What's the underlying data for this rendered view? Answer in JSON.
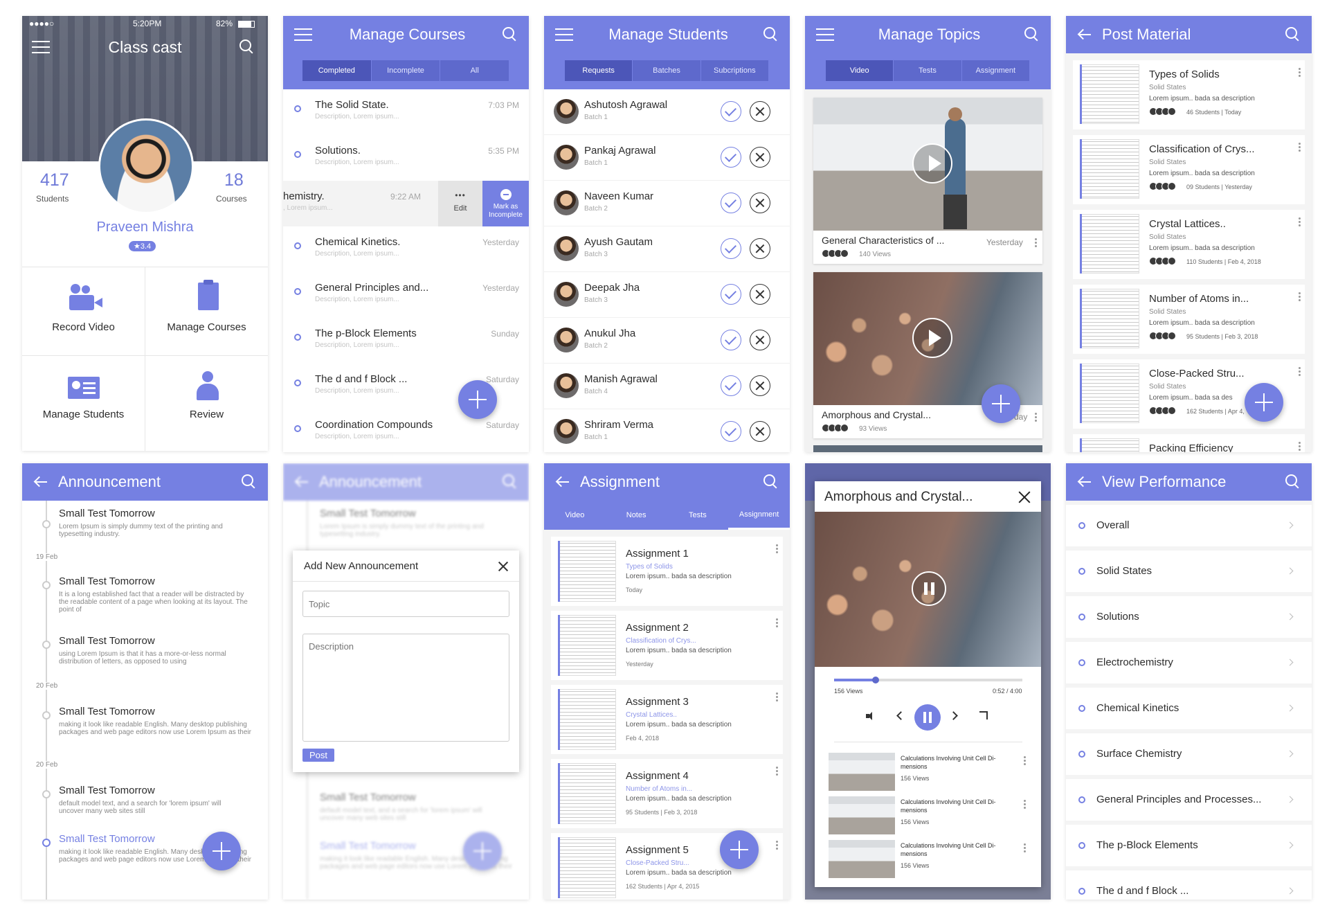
{
  "profile": {
    "status": {
      "carrier": "●●●●○",
      "time": "5:20PM",
      "battery": "82%"
    },
    "title": "Class cast",
    "students_count": "417",
    "students_label": "Students",
    "courses_count": "18",
    "courses_label": "Courses",
    "name": "Praveen Mishra",
    "rating": "★3.4",
    "tiles": [
      "Record Video",
      "Manage Courses",
      "Manage Students",
      "Review"
    ]
  },
  "courses": {
    "title": "Manage Courses",
    "tabs": [
      "Completed",
      "Incomplete",
      "All"
    ],
    "items": [
      {
        "title": "The Solid State.",
        "desc": "Description, Lorem ipsum...",
        "time": "7:03 PM"
      },
      {
        "title": "Solutions.",
        "desc": "Description, Lorem ipsum...",
        "time": "5:35 PM"
      },
      {
        "title": "Chemical Kinetics.",
        "desc": "Description, Lorem ipsum...",
        "time": "Yesterday"
      },
      {
        "title": "General Principles and...",
        "desc": "Description, Lorem ipsum...",
        "time": "Yesterday"
      },
      {
        "title": "The p-Block Elements",
        "desc": "Description, Lorem ipsum...",
        "time": "Sunday"
      },
      {
        "title": "The d and f Block ...",
        "desc": "Description, Lorem ipsum...",
        "time": "Saturday"
      },
      {
        "title": "Coordination Compounds",
        "desc": "Description, Lorem ipsum...",
        "time": "Saturday"
      }
    ],
    "swiped": {
      "title": "hemistry.",
      "desc": ", Lorem ipsum...",
      "time": "9:22 AM",
      "edit": "Edit",
      "mark": "Mark as Incomplete",
      "more": "•••"
    }
  },
  "students": {
    "title": "Manage Students",
    "tabs": [
      "Requests",
      "Batches",
      "Subcriptions"
    ],
    "items": [
      {
        "name": "Ashutosh Agrawal",
        "batch": "Batch 1"
      },
      {
        "name": "Pankaj Agrawal",
        "batch": "Batch 1"
      },
      {
        "name": "Naveen Kumar",
        "batch": "Batch 2"
      },
      {
        "name": "Ayush Gautam",
        "batch": "Batch 3"
      },
      {
        "name": "Deepak Jha",
        "batch": "Batch 3"
      },
      {
        "name": "Anukul Jha",
        "batch": "Batch 2"
      },
      {
        "name": "Manish Agrawal",
        "batch": "Batch 4"
      },
      {
        "name": "Shriram Verma",
        "batch": "Batch 1"
      }
    ]
  },
  "topics": {
    "title": "Manage Topics",
    "tabs": [
      "Video",
      "Tests",
      "Assignment"
    ],
    "videos": [
      {
        "title": "General Characteristics of ...",
        "views": "140 Views",
        "time": "Yesterday"
      },
      {
        "title": "Amorphous and Crystal...",
        "views": "93 Views",
        "time": "day"
      }
    ]
  },
  "material": {
    "title": "Post Material",
    "items": [
      {
        "title": "Types of Solids",
        "sub": "Solid States",
        "desc": "Lorem ipsum.. bada sa description",
        "meta": "46 Students | Today"
      },
      {
        "title": "Classification of Crys...",
        "sub": "Solid States",
        "desc": "Lorem ipsum.. bada sa description",
        "meta": "09 Students | Yesterday"
      },
      {
        "title": "Crystal Lattices..",
        "sub": "Solid States",
        "desc": "Lorem ipsum.. bada sa description",
        "meta": "110 Students | Feb 4, 2018"
      },
      {
        "title": "Number of Atoms in...",
        "sub": "Solid States",
        "desc": "Lorem ipsum.. bada sa description",
        "meta": "95 Students | Feb 3, 2018"
      },
      {
        "title": "Close-Packed Stru...",
        "sub": "Solid States",
        "desc": "Lorem ipsum.. bada sa des",
        "meta": "162 Students | Apr 4,"
      },
      {
        "title": "Packing Efficiency",
        "sub": "",
        "desc": "",
        "meta": ""
      }
    ]
  },
  "announce": {
    "title": "Announcement",
    "dates": [
      "19 Feb",
      "20 Feb",
      "20 Feb"
    ],
    "items": [
      {
        "title": "Small Test Tomorrow",
        "desc": "Lorem Ipsum is simply dummy text of the printing and typesetting industry."
      },
      {
        "title": "Small Test Tomorrow",
        "desc": "It is a long established fact that a reader will be distracted by the readable content of a page when looking at its layout. The point of"
      },
      {
        "title": "Small Test Tomorrow",
        "desc": "using Lorem Ipsum is that it has a more-or-less normal distribution of letters, as opposed to using"
      },
      {
        "title": "Small Test Tomorrow",
        "desc": "making it look like readable English. Many desktop publishing packages and web page editors now use Lorem Ipsum as their"
      },
      {
        "title": "Small Test Tomorrow",
        "desc": "default model text, and a search for 'lorem ipsum' will uncover many web sites still"
      },
      {
        "title": "Small Test Tomorrow",
        "desc": "making it look like readable English. Many desktop publishing packages and web page editors now use Lorem Ipsum as their"
      }
    ]
  },
  "dialog": {
    "title": "Add New Announcement",
    "topic_placeholder": "Topic",
    "desc_placeholder": "Description",
    "post": "Post"
  },
  "assignment": {
    "title": "Assignment",
    "tabs": [
      "Video",
      "Notes",
      "Tests",
      "Assignment"
    ],
    "items": [
      {
        "title": "Assignment 1",
        "topic": "Types of Solids",
        "desc": "Lorem ipsum.. bada sa description",
        "meta": "Today"
      },
      {
        "title": "Assignment 2",
        "topic": "Classification of Crys...",
        "desc": "Lorem ipsum.. bada sa description",
        "meta": "Yesterday"
      },
      {
        "title": "Assignment 3",
        "topic": "Crystal Lattices..",
        "desc": "Lorem ipsum.. bada sa description",
        "meta": "Feb 4, 2018"
      },
      {
        "title": "Assignment 4",
        "topic": "Number of Atoms in...",
        "desc": "Lorem ipsum.. bada sa description",
        "meta": "95 Students | Feb 3, 2018"
      },
      {
        "title": "Assignment 5",
        "topic": "Close-Packed Stru...",
        "desc": "Lorem ipsum.. bada sa description",
        "meta": "162 Students | Apr 4, 2015"
      }
    ]
  },
  "player": {
    "title": "Amorphous and Crystal...",
    "views": "156 Views",
    "time": "0:52 / 4:00",
    "progress": 0.22,
    "related": [
      {
        "title": "Calculations Involving Unit Cell Di-mensions",
        "views": "156 Views"
      },
      {
        "title": "Calculations Involving Unit Cell Di-mensions",
        "views": "156 Views"
      },
      {
        "title": "Calculations Involving Unit Cell Di-mensions",
        "views": "156 Views"
      }
    ]
  },
  "performance": {
    "title": "View Performance",
    "items": [
      "Overall",
      "Solid States",
      "Solutions",
      "Electrochemistry",
      "Chemical Kinetics",
      "Surface Chemistry",
      "General Principles and Processes...",
      "The p-Block Elements",
      "The d and f Block ..."
    ]
  },
  "colors": {
    "accent": "#7580e2",
    "accent_dark": "#4c56b8"
  }
}
